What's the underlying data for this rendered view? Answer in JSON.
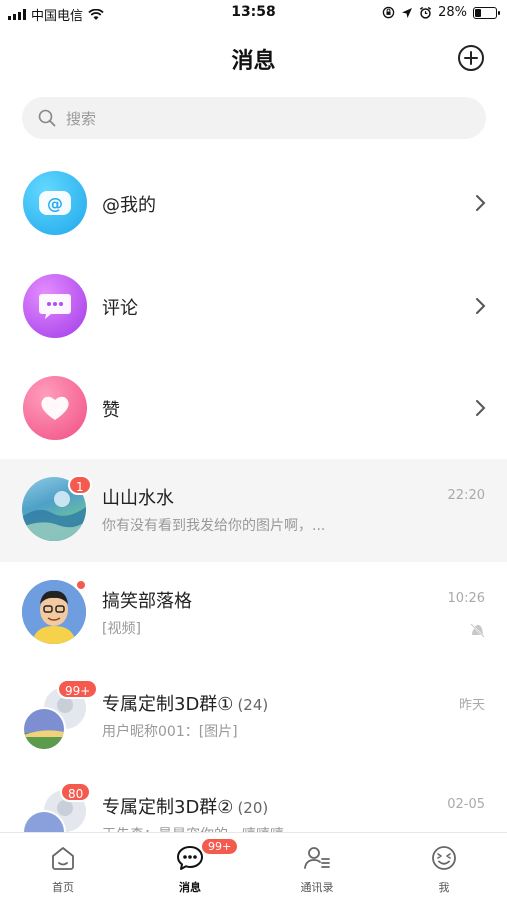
{
  "status_bar": {
    "carrier": "中国电信",
    "time": "13:58",
    "battery": "28%",
    "battery_level": 0.28
  },
  "nav": {
    "title": "消息",
    "add_icon": "plus-circle-icon"
  },
  "search": {
    "placeholder": "搜索",
    "icon": "search-icon"
  },
  "menu": [
    {
      "label": "@我的",
      "icon": "at-icon",
      "color": "#29b6f6"
    },
    {
      "label": "评论",
      "icon": "comment-bubble-icon",
      "color": "#b146f0"
    },
    {
      "label": "赞",
      "icon": "heart-icon",
      "color": "#f45b8b"
    }
  ],
  "conversations": [
    {
      "title": "山山水水",
      "count": "",
      "preview": "你有没有看到我发给你的图片啊，...",
      "time": "22:20",
      "badge": "1"
    },
    {
      "title": "搞笑部落格",
      "count": "",
      "preview": "[视频]",
      "time": "10:26",
      "badge": ""
    },
    {
      "title": "专属定制3D群①",
      "count": "(24)",
      "preview": "用户昵称001：[图片]",
      "time": "昨天",
      "badge": "99+"
    },
    {
      "title": "专属定制3D群②",
      "count": "(20)",
      "preview": "王先森：最是宠你的，嘻嘻嘻",
      "time": "02-05",
      "badge": "80"
    }
  ],
  "tabs": [
    {
      "label": "首页",
      "icon": "home-icon",
      "badge": ""
    },
    {
      "label": "消息",
      "icon": "message-icon",
      "badge": "99+"
    },
    {
      "label": "通讯录",
      "icon": "contacts-icon",
      "badge": ""
    },
    {
      "label": "我",
      "icon": "smiley-icon",
      "badge": ""
    }
  ],
  "colors": {
    "badge": "#f55a4e",
    "search_bg": "#f2f2f2",
    "highlight_bg": "#f5f5f5"
  }
}
